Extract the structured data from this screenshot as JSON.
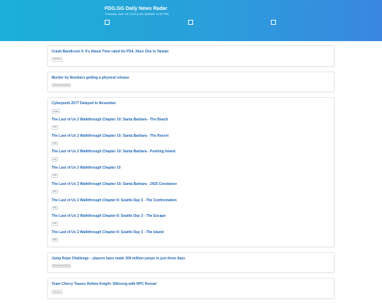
{
  "header": {
    "title": "FDG.GG Daily News Radar",
    "subtitle": "Thursday, June 18, 2020 (Last Updated: 11:52 PM)"
  },
  "groups": [
    {
      "items": [
        {
          "title": "Crash Bandicoot 4: It's About Time rated for PS4, Xbox One in Taiwan",
          "source": "Gematsu"
        }
      ]
    },
    {
      "items": [
        {
          "title": "Murder by Numbers getting a physical release",
          "source": "Nintendo Everything"
        }
      ]
    },
    {
      "items": [
        {
          "title": "Cyberpunk 2077 Delayed to November",
          "source": "Kotaku"
        },
        {
          "title": "The Last of Us 2 Walkthrough Chapter 10: Santa Barbara - The Beach",
          "source": "IGN"
        },
        {
          "title": "The Last of Us 2 Walkthrough Chapter 10: Santa Barbara - The Resort",
          "source": "IGN"
        },
        {
          "title": "The Last of Us 2 Walkthrough Chapter 10: Santa Barbara - Pushing Inland",
          "source": "IGN"
        },
        {
          "title": "The Last of Us 2 Walkthrough Chapter 10",
          "source": "IGN"
        },
        {
          "title": "The Last of Us 2 Walkthrough Chapter 10: Santa Barbara - 2425 Constance",
          "source": "IGN"
        },
        {
          "title": "The Last of Us 2 Walkthrough Chapter 8: Seattle Day 3 - The Confrontation",
          "source": "IGN"
        },
        {
          "title": "The Last of Us 2 Walkthrough Chapter 8: Seattle Day 3 - The Escape",
          "source": "IGN"
        },
        {
          "title": "The Last of Us 2 Walkthrough Chapter 8: Seattle Day 3 - The Island",
          "source": "IGN"
        }
      ]
    },
    {
      "items": [
        {
          "title": "Jump Rope Challenge – players have made 200 million jumps in just three days",
          "source": "Nintendo Everything"
        }
      ]
    },
    {
      "items": [
        {
          "title": "Team Cherry Teases Hollow Knight: Silksong with NPC Reveal",
          "source": "Gematsu"
        }
      ]
    }
  ]
}
